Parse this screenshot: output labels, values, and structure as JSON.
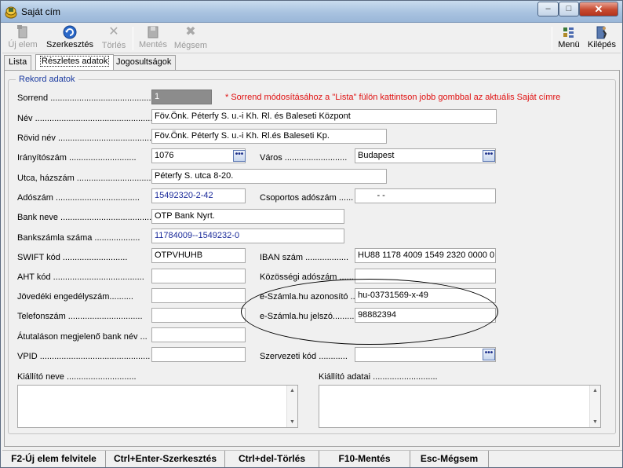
{
  "window": {
    "title": "Saját cím",
    "min": "‒",
    "max": "□",
    "close": "✕"
  },
  "toolbar": {
    "new_label": "Új elem",
    "edit_label": "Szerkesztés",
    "delete_label": "Törlés",
    "save_label": "Mentés",
    "cancel_label": "Mégsem",
    "menu_label": "Menü",
    "exit_label": "Kilépés"
  },
  "tabs": [
    "Lista",
    "Részletes adatok",
    "Jogosultságok"
  ],
  "group_title": "Rekord adatok",
  "note": "* Sorrend módosításához a \"Lista\" fülön kattintson jobb gombbal az aktuális Saját címre",
  "labels": {
    "sorrend": "Sorrend ..........................................",
    "nev": "Név ..........................................................",
    "rovid_nev": "Rövid név ................................................",
    "iranyitoszam": "Irányítószám ............................",
    "varos": "Város ..........................",
    "utca": "Utca, házszám ..........................................",
    "adoszam": "Adószám ...................................",
    "csoportos_adoszam": "Csoportos adószám ......",
    "bank_neve": "Bank neve .........................................",
    "bankszamla": "Bankszámla száma ...................",
    "swift": "SWIFT kód ...........................",
    "iban": "IBAN szám ..................",
    "aht": "AHT kód ......................................",
    "kozossegi": "Közösségi adószám ......",
    "jovedeki": "Jövedéki engedélyszám..........",
    "eszamla_azon": "e-Számla.hu azonosító ....",
    "telefonszam": "Telefonszám ...............................",
    "eszamla_jelszo": "e-Számla.hu jelszó.........",
    "atutalason": "Átutaláson megjelenő bank név ...",
    "vpid": "VPID ..............................................",
    "szervezeti": "Szervezeti kód ............",
    "kiallito_neve": "Kiállító neve .............................",
    "kiallito_adatai": "Kiállító adatai ..........................."
  },
  "values": {
    "sorrend": "1",
    "nev": "Föv.Önk. Péterfy S. u.-i Kh. Rl. és Baleseti  Központ",
    "rovid_nev": "Föv.Önk. Péterfy S. u.-i Kh. Rl.és Baleseti Kp.",
    "iranyitoszam": "1076",
    "varos": "Budapest",
    "utca": "Péterfy S. utca 8-20.",
    "adoszam": "15492320-2-42",
    "csoportos_adoszam": "        - -",
    "bank_neve": "OTP Bank Nyrt.",
    "bankszamla": "11784009--1549232-0",
    "swift": "OTPVHUHB",
    "iban": "HU88 1178 4009 1549 2320 0000 0",
    "aht": "",
    "kozossegi": "",
    "jovedeki": "",
    "eszamla_azon": "hu-03731569-x-49",
    "telefonszam": "",
    "eszamla_jelszo": "98882394",
    "atutalason": "",
    "vpid": "",
    "szervezeti": "",
    "kiallito_neve": "",
    "kiallito_adatai": ""
  },
  "dots_label": "•••",
  "statusbar": [
    "F2-Új elem felvitele",
    "Ctrl+Enter-Szerkesztés",
    "Ctrl+del-Törlés",
    "F10-Mentés",
    "Esc-Mégsem"
  ],
  "icons": {
    "app": "app-icon",
    "new": "new-document-icon",
    "edit": "edit-refresh-icon",
    "delete": "delete-x-icon",
    "save": "save-disk-icon",
    "cancel": "cancel-x-icon",
    "menu": "menu-grid-icon",
    "exit": "exit-door-icon"
  },
  "colors": {
    "note": "#e01010",
    "group_title": "#1a3aa0",
    "blue_value": "#1a2a9a"
  }
}
